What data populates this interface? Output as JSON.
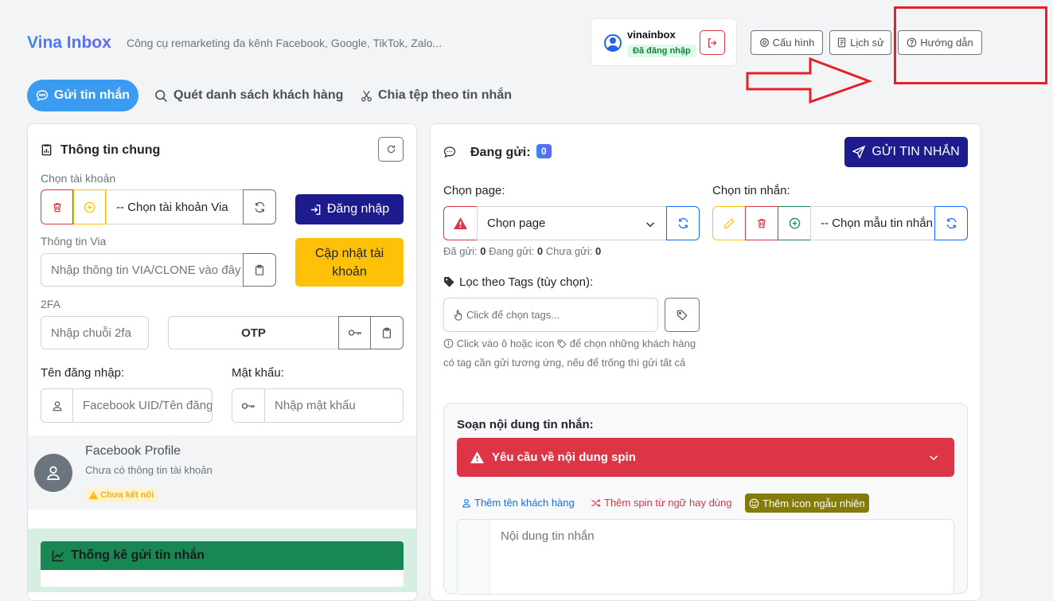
{
  "header": {
    "title": "Vina Inbox",
    "subtitle": "Công cụ remarketing đa kênh Facebook, Google, TikTok, Zalo..."
  },
  "user": {
    "name": "vinainbox",
    "status": "Đã đăng nhập"
  },
  "top_buttons": {
    "config": "Cấu hình",
    "history": "Lịch sử",
    "guide": "Hướng dẫn"
  },
  "tabs": [
    {
      "label": "Gửi tin nhắn",
      "active": true
    },
    {
      "label": "Quét danh sách khách hàng"
    },
    {
      "label": "Chia tệp theo tin nhắn"
    }
  ],
  "left_panel": {
    "title": "Thông tin chung",
    "account_label": "Chọn tài khoản",
    "account_select": "-- Chọn tài khoản Via",
    "login_button": "Đăng nhập",
    "via_label": "Thông tin Via",
    "via_placeholder": "Nhập thông tin VIA/CLONE vào đây",
    "update_button": "Cập nhật tài khoản",
    "twofa_label": "2FA",
    "twofa_placeholder": "Nhập chuỗi 2fa",
    "otp_label": "OTP",
    "username_label": "Tên đăng nhập:",
    "username_placeholder": "Facebook UID/Tên đăng nhập",
    "password_label": "Mật khẩu:",
    "password_placeholder": "Nhập mật khẩu",
    "profile": {
      "title": "Facebook Profile",
      "desc": "Chưa có thông tin tài khoản",
      "status": "Chưa kết nối"
    },
    "stats_title": "Thống kê gửi tin nhắn"
  },
  "right_panel": {
    "sending_label": "Đang gửi:",
    "sending_count": "0",
    "send_button": "GỬI TIN NHẮN",
    "page_label": "Chọn page:",
    "page_select": "Chọn page",
    "counts": {
      "sent_label": "Đã gửi:",
      "sent": "0",
      "sending_label": "Đang gửi:",
      "sending": "0",
      "unsent_label": "Chưa gửi:",
      "unsent": "0"
    },
    "message_label": "Chọn tin nhắn:",
    "message_select": "-- Chọn mẫu tin nhắn",
    "tags_label": "Lọc theo Tags (tùy chọn):",
    "tags_placeholder": "Click để chọn tags...",
    "tags_help": "Click vào ô hoặc icon để chọn những khách hàng có tag cần gửi tương ứng, nếu để trống thì gửi tất cả",
    "tags_help_part1": "Click vào ô hoặc icon",
    "tags_help_part2": "để chọn những khách hàng có tag cần gửi tương ứng, nếu để trống thì gửi tất cả",
    "compose_title": "Soạn nội dung tin nhắn:",
    "spin_alert": "Yêu cầu về nội dung spin",
    "insert_name": "Thêm tên khách hàng",
    "insert_spin": "Thêm spin từ ngữ hay dùng",
    "insert_icon": "Thêm icon ngẫu nhiên",
    "message_placeholder": "Nội dung tin nhắn"
  },
  "colors": {
    "primary": "#3b9bf0",
    "navy": "#1e1b8f",
    "warning": "#ffc107",
    "danger": "#dc3545",
    "success": "#198754",
    "annotation": "#e32227"
  }
}
